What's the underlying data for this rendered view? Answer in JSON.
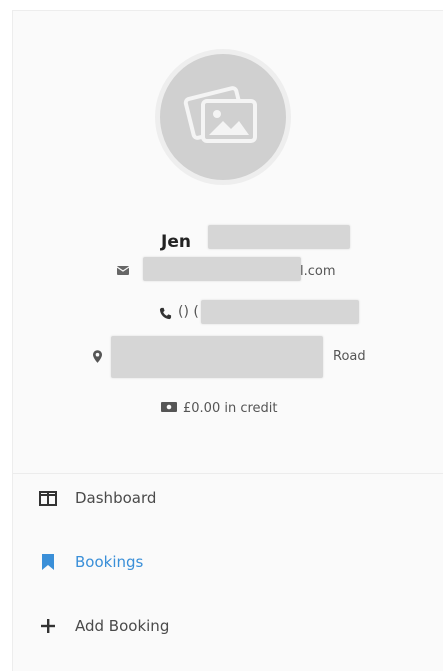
{
  "profile": {
    "first_name": "Jen",
    "email_suffix": "l.com",
    "phone_prefix": "() (",
    "address_suffix": "Road",
    "credit": "£0.00 in credit"
  },
  "icons": {
    "avatar": "image-placeholder-icon",
    "email": "envelope-icon",
    "phone": "phone-icon",
    "address": "map-pin-icon",
    "credit": "cash-icon"
  },
  "nav": [
    {
      "label": "Dashboard",
      "icon": "columns-icon",
      "active": false
    },
    {
      "label": "Bookings",
      "icon": "bookmark-icon",
      "active": true
    },
    {
      "label": "Add Booking",
      "icon": "plus-icon",
      "active": false
    }
  ],
  "colors": {
    "accent": "#3a8fd8",
    "avatar_bg": "#d0d0d0"
  }
}
